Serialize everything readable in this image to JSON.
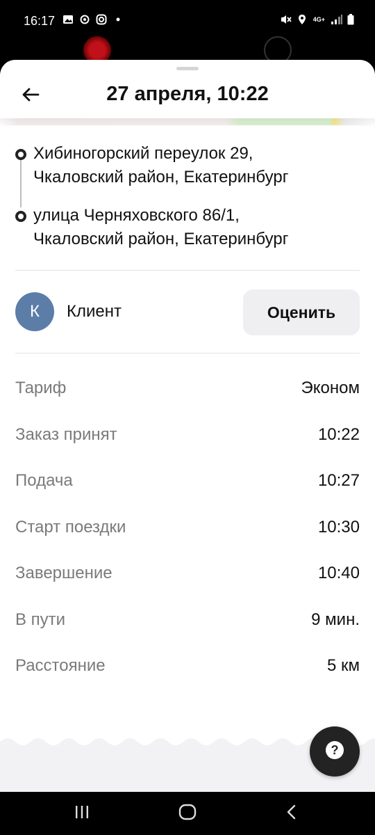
{
  "status_bar": {
    "time": "16:17",
    "left_icons": [
      "gallery-icon",
      "location-target-icon",
      "instagram-icon",
      "dot-icon"
    ],
    "right_icons": [
      "mute-icon",
      "location-pin-icon",
      "network-4g-icon",
      "signal-icon",
      "battery-icon"
    ],
    "network_label": "4G+"
  },
  "header": {
    "title": "27 апреля, 10:22",
    "back_icon": "arrow-left-icon"
  },
  "route": {
    "stops": [
      {
        "line1": "Хибиногорский переулок 29,",
        "line2": "Чкаловский район, Екатеринбург"
      },
      {
        "line1": "улица Черняховского 86/1,",
        "line2": "Чкаловский район, Екатеринбург"
      }
    ]
  },
  "client": {
    "avatar_letter": "К",
    "name": "Клиент",
    "rate_label": "Оценить",
    "avatar_color": "#5b7da8"
  },
  "details": [
    {
      "label": "Тариф",
      "value": "Эконом"
    },
    {
      "label": "Заказ принят",
      "value": "10:22"
    },
    {
      "label": "Подача",
      "value": "10:27"
    },
    {
      "label": "Старт поездки",
      "value": "10:30"
    },
    {
      "label": "Завершение",
      "value": "10:40"
    },
    {
      "label": "В пути",
      "value": "9 мин."
    },
    {
      "label": "Расстояние",
      "value": "5 км"
    }
  ],
  "help": {
    "icon": "question-icon",
    "glyph": "?"
  },
  "nav_bar": {
    "icons": [
      "recents-icon",
      "home-icon",
      "back-icon"
    ]
  }
}
